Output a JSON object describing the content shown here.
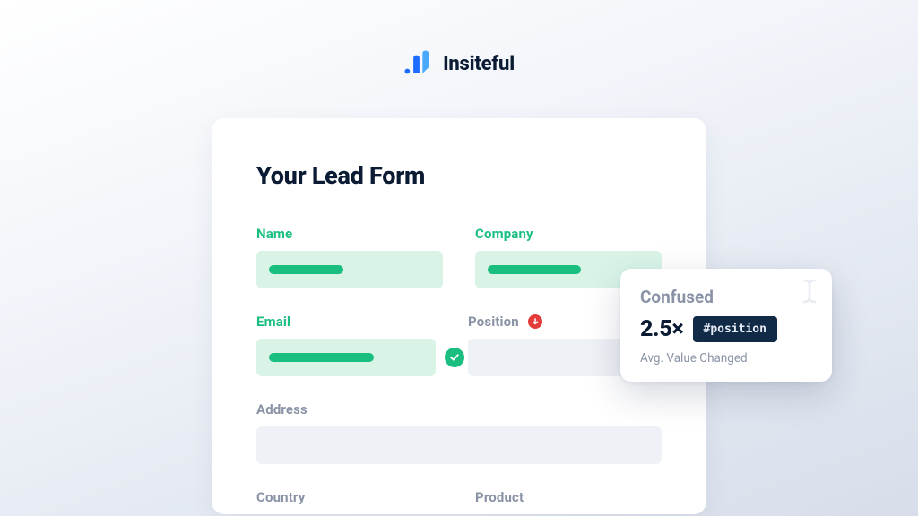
{
  "brand": {
    "name": "Insiteful"
  },
  "form": {
    "title": "Your Lead Form",
    "fields": {
      "name": {
        "label": "Name",
        "status": "ok",
        "fill_pct": 46
      },
      "company": {
        "label": "Company",
        "status": "ok",
        "fill_pct": 58
      },
      "email": {
        "label": "Email",
        "status": "ok",
        "fill_pct": 68,
        "validated": true
      },
      "position": {
        "label": "Position",
        "status": "issue",
        "trend": "down"
      },
      "address": {
        "label": "Address",
        "status": "muted"
      },
      "country": {
        "label": "Country",
        "status": "muted"
      },
      "product": {
        "label": "Product",
        "status": "muted"
      }
    }
  },
  "insight": {
    "title": "Confused",
    "metric": "2.5×",
    "field_id": "#position",
    "caption": "Avg. Value Changed"
  },
  "colors": {
    "accent_green": "#1abf80",
    "accent_green_bg": "#d9f4e7",
    "danger": "#e43b3b",
    "navy": "#112a46",
    "text": "#0b1b34",
    "muted": "#8a93a6"
  }
}
